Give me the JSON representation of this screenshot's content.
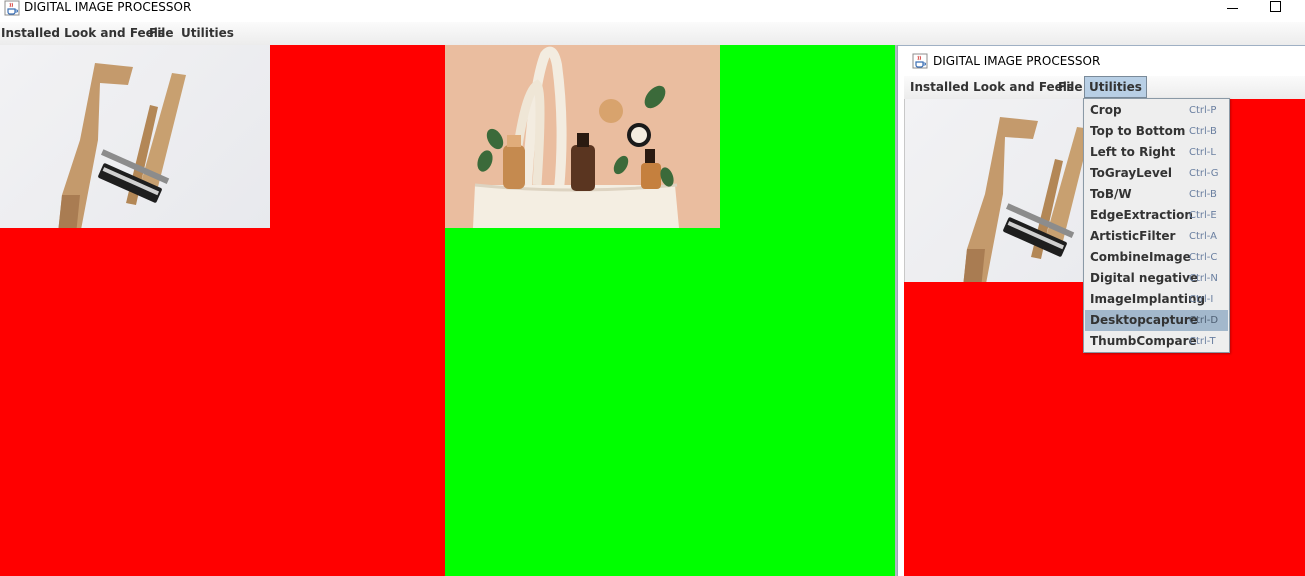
{
  "outer_window": {
    "title": "DIGITAL IMAGE PROCESSOR",
    "menu": [
      "Installed Look and Feels",
      "File",
      "Utilities"
    ]
  },
  "inner_window": {
    "title": "DIGITAL IMAGE PROCESSOR",
    "menu": [
      "Installed Look and Feels",
      "File",
      "Utilities"
    ],
    "open_menu": "Utilities"
  },
  "utilities_menu": {
    "items": [
      {
        "label": "Crop",
        "accelerator": "Ctrl-P"
      },
      {
        "label": "Top to Bottom",
        "accelerator": "Ctrl-B"
      },
      {
        "label": "Left to Right",
        "accelerator": "Ctrl-L"
      },
      {
        "label": "ToGrayLevel",
        "accelerator": "Ctrl-G"
      },
      {
        "label": "ToB/W",
        "accelerator": "Ctrl-B"
      },
      {
        "label": "EdgeExtraction",
        "accelerator": "Ctrl-E"
      },
      {
        "label": "ArtisticFilter",
        "accelerator": "Ctrl-A"
      },
      {
        "label": "CombineImage",
        "accelerator": "Ctrl-C"
      },
      {
        "label": "Digital negative",
        "accelerator": "Ctrl-N"
      },
      {
        "label": "ImageImplanting",
        "accelerator": "Ctrl-I"
      },
      {
        "label": "Desktopcapture",
        "accelerator": "Ctrl-D"
      },
      {
        "label": "ThumbCompare",
        "accelerator": "Ctrl-T"
      }
    ],
    "highlighted_item": "Desktopcapture"
  },
  "colors": {
    "panel_left": "#ff0000",
    "panel_middle": "#00ff00",
    "panel_inner": "#ff0000",
    "menu_highlight": "#a3b8cc"
  },
  "icons": {
    "app": "java-coffee-cup-icon",
    "minimize": "minimize-icon",
    "maximize": "maximize-icon"
  }
}
